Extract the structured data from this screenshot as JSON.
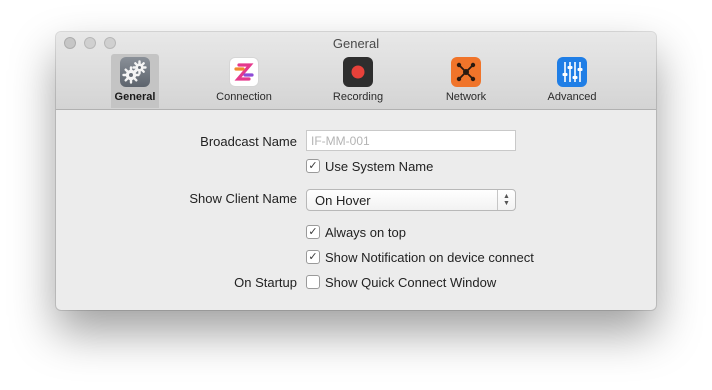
{
  "window": {
    "title": "General"
  },
  "toolbar": {
    "tabs": [
      {
        "label": "General",
        "icon": "gear-icon",
        "active": true
      },
      {
        "label": "Connection",
        "icon": "connection-icon",
        "active": false
      },
      {
        "label": "Recording",
        "icon": "record-icon",
        "active": false
      },
      {
        "label": "Network",
        "icon": "network-icon",
        "active": false
      },
      {
        "label": "Advanced",
        "icon": "sliders-icon",
        "active": false
      }
    ]
  },
  "form": {
    "broadcast_name_label": "Broadcast Name",
    "broadcast_name_placeholder": "IF-MM-001",
    "broadcast_name_value": "",
    "use_system_name_label": "Use System Name",
    "use_system_name_checked": true,
    "show_client_name_label": "Show Client Name",
    "show_client_name_value": "On Hover",
    "always_on_top_label": "Always on top",
    "always_on_top_checked": true,
    "show_notification_label": "Show Notification on device connect",
    "show_notification_checked": true,
    "on_startup_label": "On Startup",
    "show_quick_connect_label": "Show Quick Connect Window",
    "show_quick_connect_checked": false
  },
  "colors": {
    "connection_accent": "#e5388c",
    "record_red": "#e8413a",
    "network_orange": "#f0742a",
    "advanced_blue": "#1f7ee6"
  }
}
